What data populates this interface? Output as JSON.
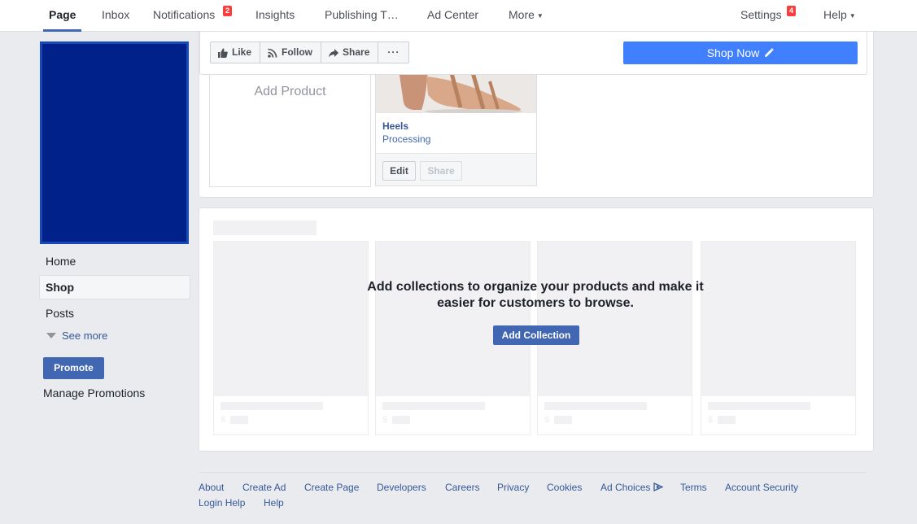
{
  "topnav": {
    "page": "Page",
    "inbox": "Inbox",
    "notifications": "Notifications",
    "notifications_count": "2",
    "insights": "Insights",
    "publishing_tools": "Publishing T…",
    "ad_center": "Ad Center",
    "more": "More",
    "settings": "Settings",
    "settings_count": "4",
    "help": "Help"
  },
  "sidebar": {
    "items": [
      "Home",
      "Shop",
      "Posts"
    ],
    "see_more": "See more",
    "promote": "Promote",
    "manage_promotions": "Manage Promotions"
  },
  "action_bar": {
    "like": "Like",
    "follow": "Follow",
    "share": "Share",
    "more": "···",
    "shop_now": "Shop Now"
  },
  "products": {
    "add_product": "Add Product",
    "items": [
      {
        "name": "Heels",
        "status": "Processing",
        "edit": "Edit",
        "share": "Share"
      }
    ]
  },
  "collections": {
    "message": "Add collections to organize your products and make it easier for customers to browse.",
    "add_button": "Add Collection",
    "placeholder_currency": "$"
  },
  "footer": {
    "links": [
      "About",
      "Create Ad",
      "Create Page",
      "Developers",
      "Careers",
      "Privacy",
      "Cookies",
      "Ad Choices",
      "Terms",
      "Account Security",
      "Login Help",
      "Help"
    ]
  },
  "colors": {
    "brand_blue": "#4267b2",
    "shop_now_blue": "#4080ff",
    "cover_blue": "#00218a",
    "badge_red": "#fa3e3e"
  }
}
